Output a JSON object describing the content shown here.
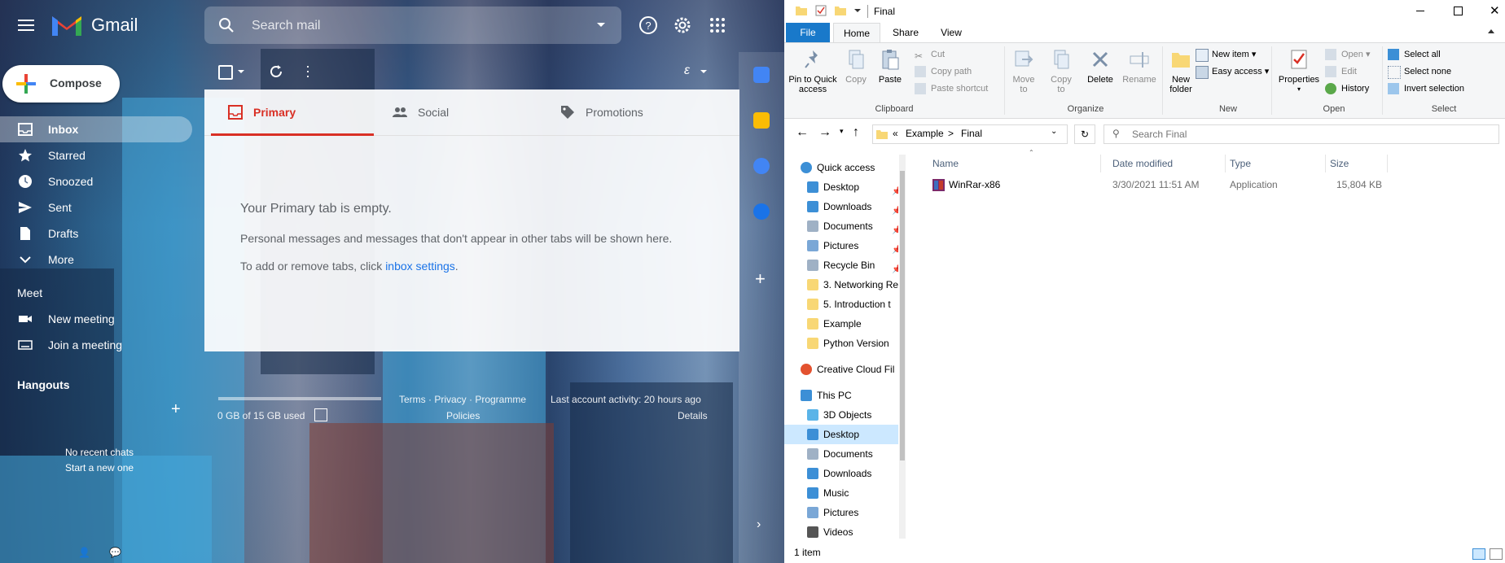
{
  "gmail": {
    "app_name": "Gmail",
    "search_placeholder": "Search mail",
    "compose_label": "Compose",
    "nav": [
      {
        "label": "Inbox",
        "icon": "inbox-icon"
      },
      {
        "label": "Starred",
        "icon": "star-icon"
      },
      {
        "label": "Snoozed",
        "icon": "clock-icon"
      },
      {
        "label": "Sent",
        "icon": "send-icon"
      },
      {
        "label": "Drafts",
        "icon": "draft-icon"
      },
      {
        "label": "More",
        "icon": "chevron-down-icon"
      }
    ],
    "meet": {
      "heading": "Meet",
      "items": [
        {
          "label": "New meeting",
          "icon": "video-icon"
        },
        {
          "label": "Join a meeting",
          "icon": "keyboard-icon"
        }
      ]
    },
    "hangouts": {
      "heading": "Hangouts",
      "no_chats": "No recent chats",
      "start_new": "Start a new one"
    },
    "tabs": [
      {
        "label": "Primary",
        "icon": "inbox-tab-icon"
      },
      {
        "label": "Social",
        "icon": "people-icon"
      },
      {
        "label": "Promotions",
        "icon": "tag-icon"
      }
    ],
    "empty_title": "Your Primary tab is empty.",
    "empty_line1": "Personal messages and messages that don't appear in other tabs will be shown here.",
    "empty_line2_prefix": "To add or remove tabs, click ",
    "empty_line2_link": "inbox settings",
    "empty_line2_suffix": ".",
    "footer": {
      "storage": "0 GB of 15 GB used",
      "storage_fraction": 0.0,
      "terms": "Terms · Privacy · Programme",
      "policies": "Policies",
      "last_activity": "Last account activity: 20 hours ago",
      "details": "Details"
    },
    "colors": {
      "accent_red": "#d93025",
      "link_blue": "#1a73e8"
    }
  },
  "explorer": {
    "title": "Final",
    "ribbon_tabs": [
      "File",
      "Home",
      "Share",
      "View"
    ],
    "clipboard": {
      "pin_quick_access": [
        "Pin to Quick",
        "access"
      ],
      "copy": "Copy",
      "paste": "Paste",
      "cut": "Cut",
      "copy_path": "Copy path",
      "paste_shortcut": "Paste shortcut",
      "group": "Clipboard"
    },
    "organize": {
      "move_to": [
        "Move",
        "to"
      ],
      "copy_to": [
        "Copy",
        "to"
      ],
      "delete": "Delete",
      "rename": "Rename",
      "group": "Organize"
    },
    "new": {
      "new_folder": [
        "New",
        "folder"
      ],
      "new_item": "New item",
      "easy_access": "Easy access",
      "group": "New"
    },
    "open": {
      "properties": "Properties",
      "open": "Open",
      "edit": "Edit",
      "history": "History",
      "group": "Open"
    },
    "select": {
      "select_all": "Select all",
      "select_none": "Select none",
      "invert_selection": "Invert selection",
      "group": "Select"
    },
    "breadcrumb": [
      "«",
      "Example",
      ">",
      "Final"
    ],
    "search_placeholder": "Search Final",
    "nav_pane": [
      {
        "label": "Quick access",
        "icon": "star-icon",
        "level": 0,
        "pinned": false
      },
      {
        "label": "Desktop",
        "icon": "desktop-icon",
        "level": 1,
        "pinned": true
      },
      {
        "label": "Downloads",
        "icon": "download-icon",
        "level": 1,
        "pinned": true
      },
      {
        "label": "Documents",
        "icon": "documents-icon",
        "level": 1,
        "pinned": true
      },
      {
        "label": "Pictures",
        "icon": "pictures-icon",
        "level": 1,
        "pinned": true
      },
      {
        "label": "Recycle Bin",
        "icon": "recycle-bin-icon",
        "level": 1,
        "pinned": true
      },
      {
        "label": "3. Networking Re",
        "icon": "folder-icon",
        "level": 1,
        "pinned": false
      },
      {
        "label": "5. Introduction t",
        "icon": "folder-icon",
        "level": 1,
        "pinned": false
      },
      {
        "label": "Example",
        "icon": "folder-icon",
        "level": 1,
        "pinned": false
      },
      {
        "label": "Python Version",
        "icon": "folder-icon",
        "level": 1,
        "pinned": false
      },
      {
        "label": "Creative Cloud Fil",
        "icon": "creative-cloud-icon",
        "level": 0,
        "pinned": false
      },
      {
        "label": "This PC",
        "icon": "pc-icon",
        "level": 0,
        "pinned": false
      },
      {
        "label": "3D Objects",
        "icon": "3d-objects-icon",
        "level": 1,
        "pinned": false
      },
      {
        "label": "Desktop",
        "icon": "desktop-icon",
        "level": 1,
        "pinned": false,
        "selected": true
      },
      {
        "label": "Documents",
        "icon": "documents-icon",
        "level": 1,
        "pinned": false
      },
      {
        "label": "Downloads",
        "icon": "download-icon",
        "level": 1,
        "pinned": false
      },
      {
        "label": "Music",
        "icon": "music-icon",
        "level": 1,
        "pinned": false
      },
      {
        "label": "Pictures",
        "icon": "pictures-icon",
        "level": 1,
        "pinned": false
      },
      {
        "label": "Videos",
        "icon": "videos-icon",
        "level": 1,
        "pinned": false
      }
    ],
    "columns": [
      "Name",
      "Date modified",
      "Type",
      "Size"
    ],
    "files": [
      {
        "name": "WinRar-x86",
        "date": "3/30/2021 11:51 AM",
        "type": "Application",
        "size": "15,804 KB",
        "icon": "winrar-icon"
      }
    ],
    "status": "1 item"
  }
}
